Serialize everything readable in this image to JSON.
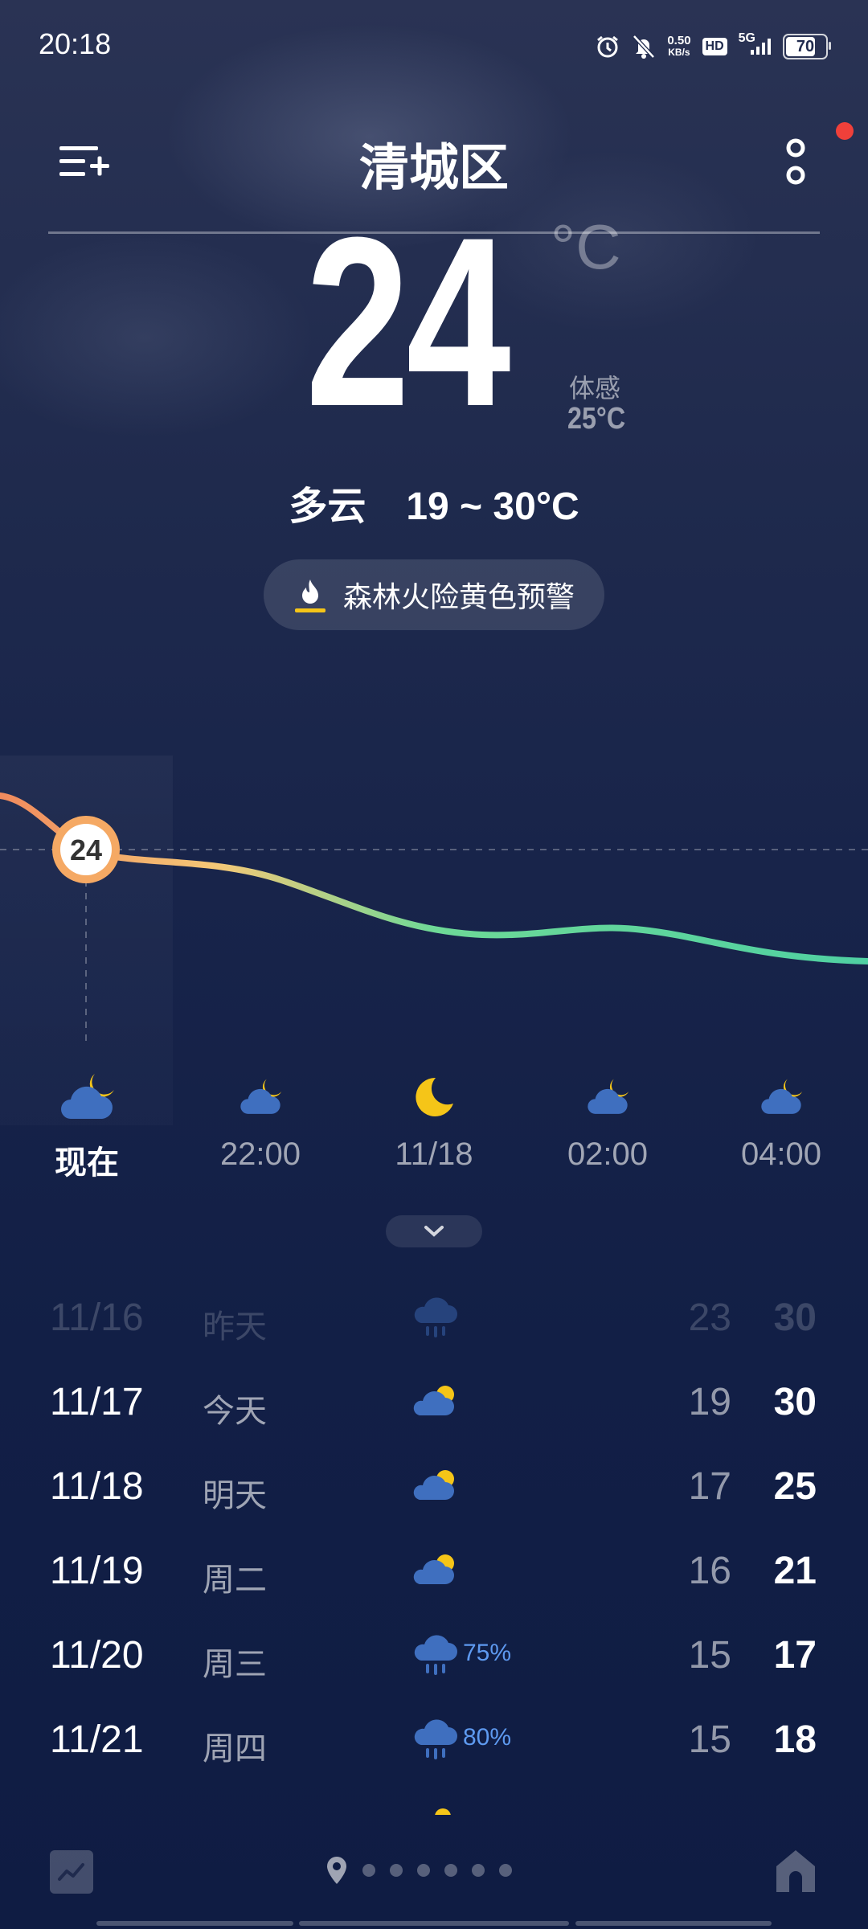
{
  "status_bar": {
    "time": "20:18",
    "net_speed_value": "0.50",
    "net_speed_unit": "KB/s",
    "hd": "HD",
    "network": "5G",
    "battery": "70"
  },
  "header": {
    "city": "清城区"
  },
  "current": {
    "temperature": "24",
    "unit": "°C",
    "feels_like_label": "体感",
    "feels_like_value": "25°C",
    "condition": "多云",
    "range": "19 ~ 30°C"
  },
  "alert": {
    "text": "森林火险黄色预警",
    "color": "#f5c518"
  },
  "chart_data": {
    "type": "line",
    "current_marker": "24"
  },
  "hourly": [
    {
      "label": "现在",
      "icon": "cloudy-night-icon"
    },
    {
      "label": "22:00",
      "icon": "cloudy-night-icon"
    },
    {
      "label": "11/18",
      "icon": "moon-icon"
    },
    {
      "label": "02:00",
      "icon": "cloudy-night-icon"
    },
    {
      "label": "04:00",
      "icon": "cloudy-night-icon"
    }
  ],
  "daily": [
    {
      "date": "11/16",
      "day": "昨天",
      "icon": "rain-icon",
      "pop": "",
      "low": "23",
      "high": "30"
    },
    {
      "date": "11/17",
      "day": "今天",
      "icon": "partly-cloudy-icon",
      "pop": "",
      "low": "19",
      "high": "30"
    },
    {
      "date": "11/18",
      "day": "明天",
      "icon": "partly-cloudy-icon",
      "pop": "",
      "low": "17",
      "high": "25"
    },
    {
      "date": "11/19",
      "day": "周二",
      "icon": "partly-cloudy-icon",
      "pop": "",
      "low": "16",
      "high": "21"
    },
    {
      "date": "11/20",
      "day": "周三",
      "icon": "rain-icon",
      "pop": "75%",
      "low": "15",
      "high": "17"
    },
    {
      "date": "11/21",
      "day": "周四",
      "icon": "rain-icon",
      "pop": "80%",
      "low": "15",
      "high": "18"
    }
  ],
  "colors": {
    "background_top": "#2a3354",
    "background_bottom": "#0f1c43",
    "cloud_icon": "#3f6fbf",
    "moon_sun": "#f5c518",
    "precip_text": "#5e9af0",
    "curve_warm": "#f08a5d",
    "curve_cool": "#5ed49c"
  }
}
